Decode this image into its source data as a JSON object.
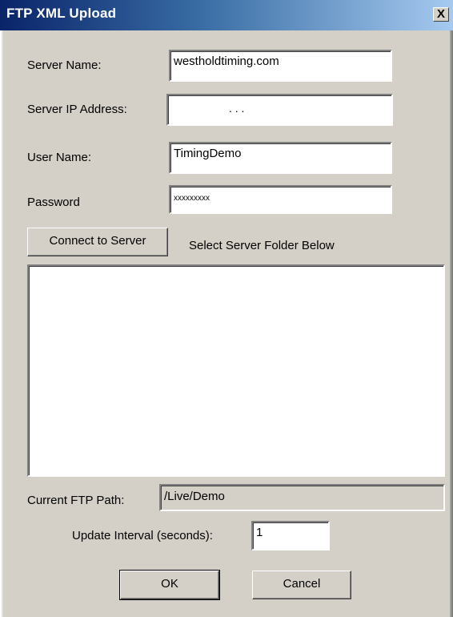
{
  "window": {
    "title": "FTP XML Upload",
    "close_glyph": "X"
  },
  "form": {
    "server_name_label": "Server Name:",
    "server_name_value": "westholdtiming.com",
    "server_ip_label": "Server IP Address:",
    "server_ip_value": ".    .    .",
    "user_name_label": "User Name:",
    "user_name_value": "TimingDemo",
    "password_label": "Password",
    "password_value": "xxxxxxxxx",
    "connect_button": "Connect to Server",
    "select_folder_label": "Select Server Folder Below",
    "current_path_label": "Current FTP Path:",
    "current_path_value": "/Live/Demo",
    "update_interval_label": "Update Interval (seconds):",
    "update_interval_value": "1"
  },
  "buttons": {
    "ok": "OK",
    "cancel": "Cancel"
  },
  "colors": {
    "title_start": "#0a246a",
    "title_end": "#a6caf0",
    "face": "#d4d0c8"
  }
}
